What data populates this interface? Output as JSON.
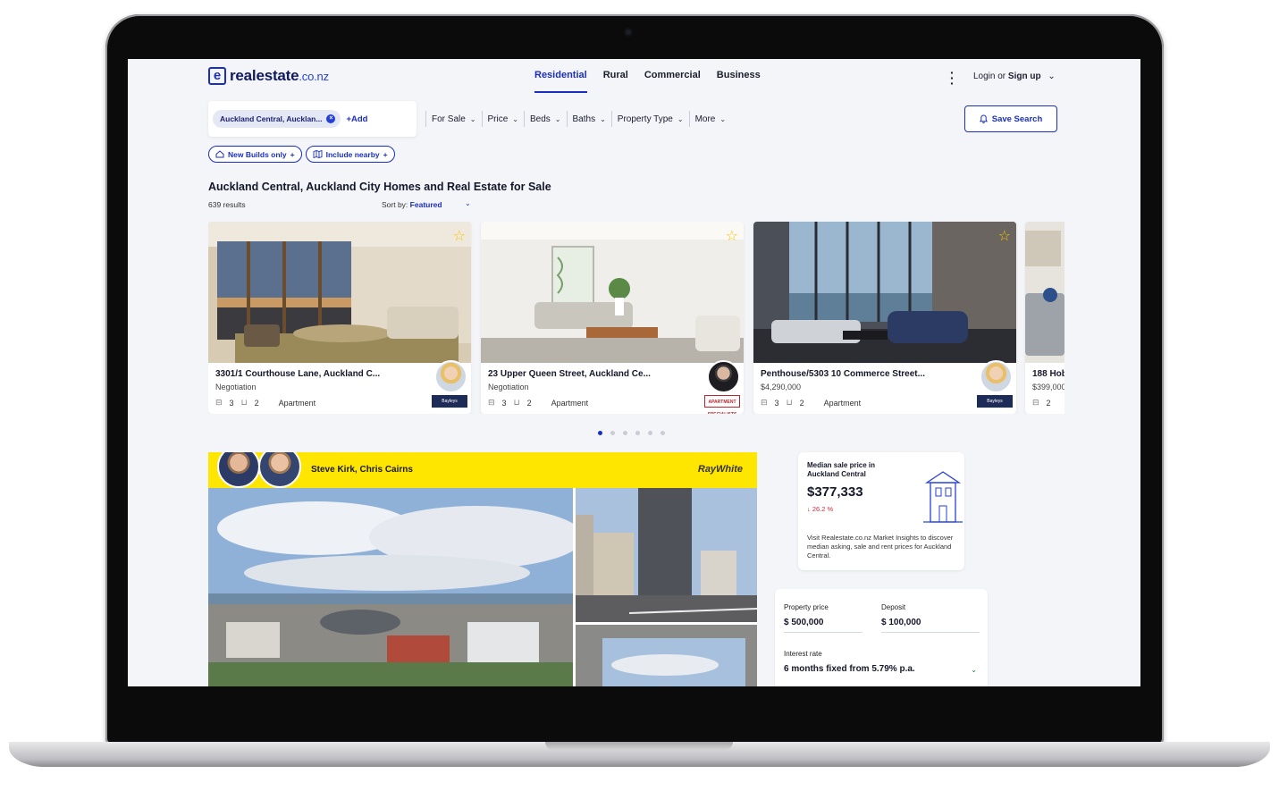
{
  "header": {
    "logo_mark": "e",
    "logo_name": "realestate",
    "logo_tld": ".co.nz",
    "nav": [
      "Residential",
      "Rural",
      "Commercial",
      "Business"
    ],
    "menu_icon": "kebab-menu-icon",
    "login_prefix": "Login or",
    "login_action": "Sign up",
    "login_caret": "⌄"
  },
  "search": {
    "chip_label": "Auckland Central, Aucklan...",
    "chip_remove": "×",
    "add_label": "+Add",
    "filters": [
      "For Sale",
      "Price",
      "Beds",
      "Baths",
      "Property Type",
      "More"
    ],
    "caret": "⌄",
    "save_label": "Save Search",
    "save_icon": "bell-icon",
    "pills": [
      {
        "label": "New Builds only",
        "plus": "+",
        "icon": "home-icon"
      },
      {
        "label": "Include nearby",
        "plus": "+",
        "icon": "map-icon"
      }
    ]
  },
  "results": {
    "title": "Auckland Central, Auckland City Homes and Real Estate for Sale",
    "count": "639 results",
    "sort_prefix": "Sort by:",
    "sort_value": "Featured",
    "sort_caret": "⌄"
  },
  "listings": [
    {
      "address": "3301/1 Courthouse Lane, Auckland C...",
      "price": "Negotiation",
      "beds": "3",
      "baths": "2",
      "type": "Apartment",
      "brand": "Bayleys",
      "star": "☆"
    },
    {
      "address": "23 Upper Queen Street, Auckland Ce...",
      "price": "Negotiation",
      "beds": "3",
      "baths": "2",
      "type": "Apartment",
      "brand": "APARTMENT SPECIALISTS",
      "star": "☆"
    },
    {
      "address": "Penthouse/5303 10 Commerce Street...",
      "price": "$4,290,000",
      "beds": "3",
      "baths": "2",
      "type": "Apartment",
      "brand": "Bayleys",
      "star": "☆"
    },
    {
      "address": "188 Hob",
      "price": "$399,000",
      "beds": "2",
      "baths": "",
      "type": "",
      "brand": "",
      "star": ""
    }
  ],
  "carousel": {
    "count": 6,
    "active": 0
  },
  "feature": {
    "agents": "Steve Kirk, Chris Cairns",
    "agency": "RayWhite"
  },
  "insight": {
    "label": "Median sale price in Auckland Central",
    "value": "$377,333",
    "change": "↓ 26.2 %",
    "description": "Visit Realestate.co.nz Market Insights to discover median asking, sale and rent prices for Auckland Central.",
    "illustration": "house-line-icon"
  },
  "calculator": {
    "property_label": "Property price",
    "property_value": "$ 500,000",
    "deposit_label": "Deposit",
    "deposit_value": "$ 100,000",
    "rate_label": "Interest rate",
    "rate_value": "6 months fixed from 5.79% p.a.",
    "rate_caret": "⌄"
  },
  "colors": {
    "brand_blue": "#1a2fbf",
    "featured_yellow": "#ffe600",
    "decline_red": "#d2293a",
    "favorite_gold": "#f5c400"
  }
}
